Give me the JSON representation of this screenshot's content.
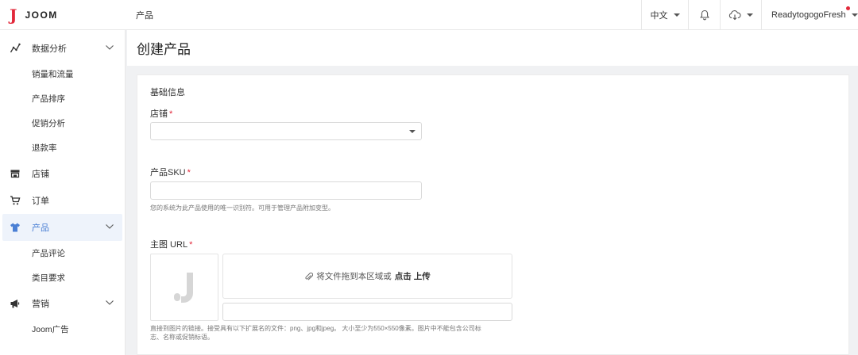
{
  "header": {
    "logo_mark": "J",
    "logo_text": "JOOM",
    "breadcrumb": "产品",
    "language": "中文",
    "username": "ReadytogogoFresh"
  },
  "sidebar": {
    "groups": [
      {
        "label": "数据分析",
        "icon": "chart-line-icon",
        "expanded": true,
        "items": [
          "销量和流量",
          "产品排序",
          "促销分析",
          "退款率"
        ]
      },
      {
        "label": "店铺",
        "icon": "store-icon"
      },
      {
        "label": "订单",
        "icon": "cart-icon"
      },
      {
        "label": "产品",
        "icon": "tshirt-icon",
        "active": true,
        "expanded": true,
        "items": [
          "产品评论",
          "类目要求"
        ]
      },
      {
        "label": "营销",
        "icon": "megaphone-icon",
        "expanded": true,
        "items": [
          "Joom广告"
        ]
      }
    ]
  },
  "page": {
    "title": "创建产品",
    "section_title": "基础信息",
    "store_label": "店铺",
    "sku_label": "产品SKU",
    "sku_hint": "您的系统为此产品使用的唯一识别符。可用于管理产品附加变型。",
    "main_image_label": "主图 URL",
    "required_mark": "*",
    "dropzone_text": "将文件拖到本区域或",
    "dropzone_action": "点击 上传",
    "image_hint_line1": "直接到图片的链接。接受具有以下扩展名的文件：png、jpg和jpeg。 大小至少为550×550像素。图片中不能包含公司标",
    "image_hint_line2": "志、名称或促销标语。"
  },
  "colors": {
    "brand": "#e2283a",
    "active_nav": "#4a7fd4",
    "placeholder_logo": "#d6d6d6"
  }
}
